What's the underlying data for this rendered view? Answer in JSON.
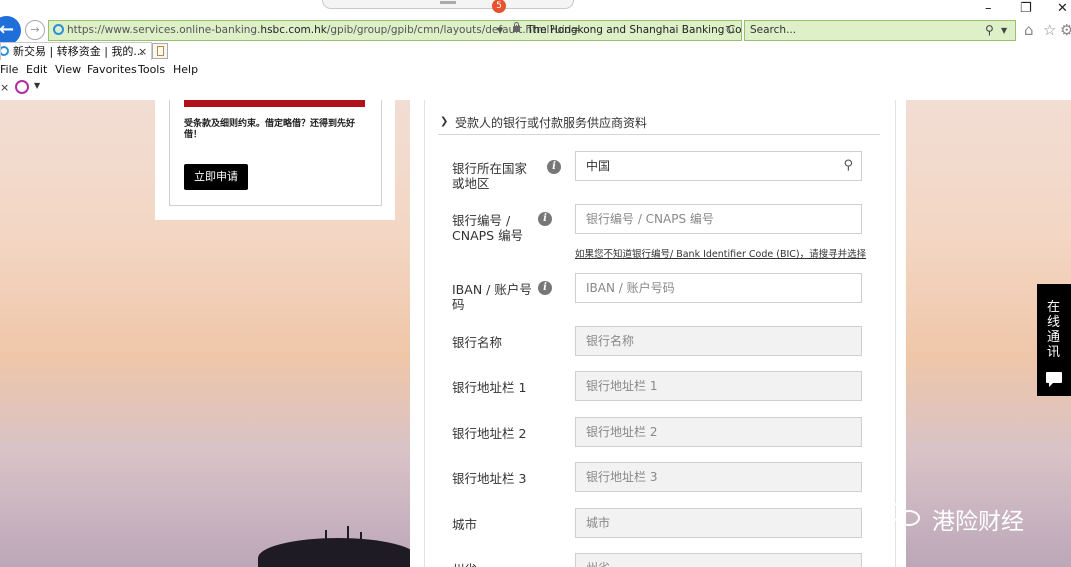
{
  "browser": {
    "tab_count_badge": "5",
    "url_prefix": "https://www.services.online-banking.",
    "url_domain": "hsbc.com.hk",
    "url_path": "/gpib/group/gpib/cmn/layouts/default.html?uid=",
    "site_identity": "The Hongkong and Shanghai Banking Corp...",
    "search_placeholder": "Search...",
    "tab_title": "新交易 | 转移资金 | 我的...",
    "tab_close": "×",
    "menu": [
      "File",
      "Edit",
      "View",
      "Favorites",
      "Tools",
      "Help"
    ],
    "command_close": "×"
  },
  "promo": {
    "text": "受条款及细则约束。借定略借？还得到先好借！",
    "button_label": "立即申请"
  },
  "form": {
    "section_title": "受款人的银行或付款服务供应商资料",
    "fields": [
      {
        "label": "银行所在国家或地区",
        "value": "中国",
        "placeholder": "",
        "info": true,
        "disabled": false
      },
      {
        "label": "银行编号 / CNAPS 编号",
        "value": "",
        "placeholder": "银行编号 / CNAPS 编号",
        "info": true,
        "disabled": false
      },
      {
        "label": "IBAN / 账户号码",
        "value": "",
        "placeholder": "IBAN / 账户号码",
        "info": true,
        "disabled": false
      },
      {
        "label": "银行名称",
        "value": "",
        "placeholder": "银行名称",
        "info": false,
        "disabled": true
      },
      {
        "label": "银行地址栏 1",
        "value": "",
        "placeholder": "银行地址栏 1",
        "info": false,
        "disabled": true
      },
      {
        "label": "银行地址栏 2",
        "value": "",
        "placeholder": "银行地址栏 2",
        "info": false,
        "disabled": true
      },
      {
        "label": "银行地址栏 3",
        "value": "",
        "placeholder": "银行地址栏 3",
        "info": false,
        "disabled": true
      },
      {
        "label": "城市",
        "value": "",
        "placeholder": "城市",
        "info": false,
        "disabled": true
      },
      {
        "label": "州省",
        "value": "",
        "placeholder": "州省",
        "info": false,
        "disabled": true
      }
    ],
    "bank_code_hint": "如果您不知道银行编号/ Bank Identifier Code (BIC)，请搜寻并选择",
    "info_glyph": "i"
  },
  "chat": {
    "label": "在线通讯"
  },
  "watermark": {
    "text": "港险财经"
  }
}
